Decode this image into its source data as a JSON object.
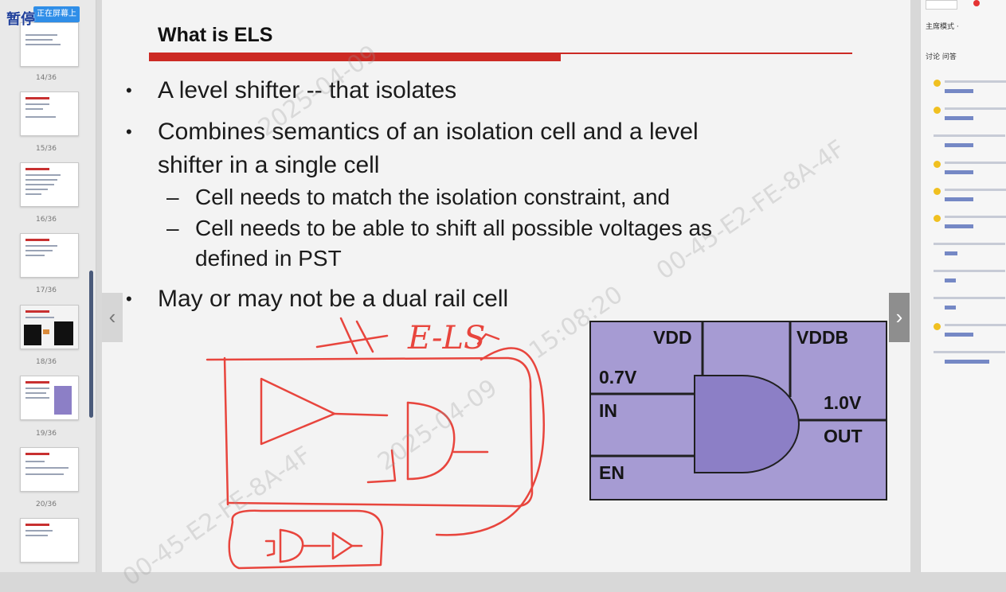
{
  "overlay": {
    "pause_label": "暂停",
    "screen_button": "正在屏幕上传"
  },
  "thumbnails": {
    "pages": [
      "14/36",
      "15/36",
      "16/36",
      "17/36",
      "18/36",
      "19/36",
      "20/36"
    ]
  },
  "slide": {
    "title": "What is ELS",
    "bullets": [
      "A level shifter -- that isolates",
      "Combines semantics of an isolation cell and a level",
      "shifter in a single cell",
      "May or may not be a dual rail cell"
    ],
    "sub_bullets": [
      "Cell needs to match the isolation constraint, and",
      "Cell needs to be able to shift all possible voltages as",
      "defined in PST"
    ],
    "diagram": {
      "vdd": "VDD",
      "vddb": "VDDB",
      "vin": "0.7V",
      "in": "IN",
      "en": "EN",
      "vout": "1.0V",
      "out": "OUT"
    },
    "annotation": "E-LS",
    "prev_icon": "chevron-left-icon",
    "next_icon": "chevron-right-icon",
    "colors": {
      "title_bar": "#cc2a24",
      "diagram_fill": "#a69bd3",
      "gate_fill": "#8c7fc6",
      "sketch": "#e8453d"
    }
  },
  "watermark": {
    "date": "2025-04-09",
    "time": "15:08:20",
    "id": "00-45-E2-FE-8A-4F"
  },
  "chat": {
    "mode_label": "主席模式 ·",
    "tabs_label": "讨论  问答"
  }
}
